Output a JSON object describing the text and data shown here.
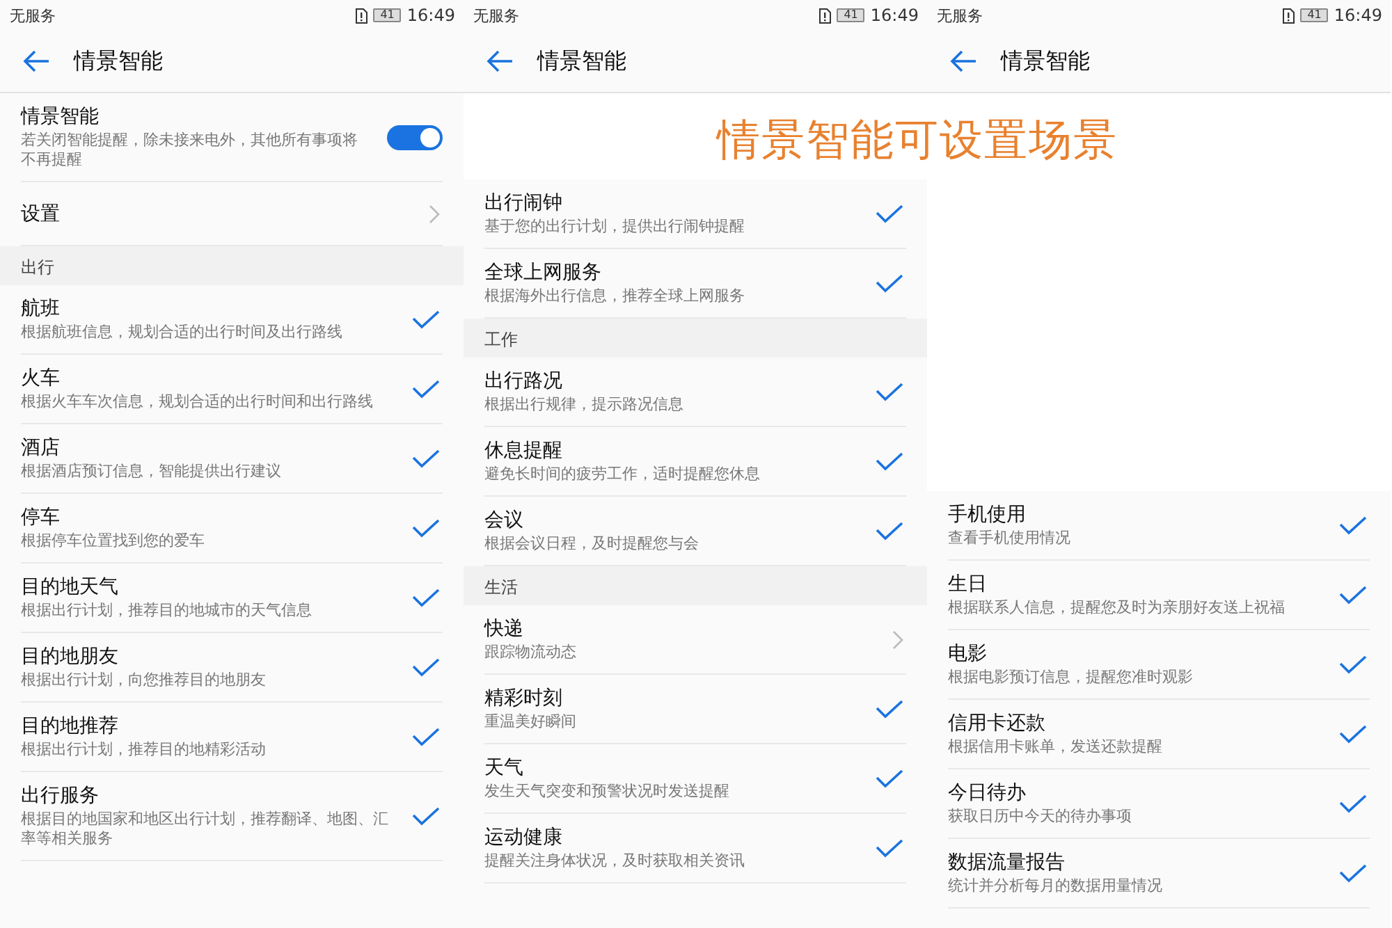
{
  "screens": [
    {
      "status_bar": {
        "carrier": "无服务",
        "battery": "41",
        "time": "16:49"
      },
      "title": "情景智能",
      "items": [
        {
          "kind": "switch",
          "title": "情景智能",
          "subtitle": "若关闭智能提醒，除未接来电外，其他所有事项将不再提醒",
          "on": true
        },
        {
          "kind": "link",
          "title": "设置"
        },
        {
          "kind": "section",
          "title": "出行"
        },
        {
          "kind": "check",
          "title": "航班",
          "subtitle": "根据航班信息，规划合适的出行时间及出行路线",
          "checked": true
        },
        {
          "kind": "check",
          "title": "火车",
          "subtitle": "根据火车车次信息，规划合适的出行时间和出行路线",
          "checked": true
        },
        {
          "kind": "check",
          "title": "酒店",
          "subtitle": "根据酒店预订信息，智能提供出行建议",
          "checked": true
        },
        {
          "kind": "check",
          "title": "停车",
          "subtitle": "根据停车位置找到您的爱车",
          "checked": true
        },
        {
          "kind": "check",
          "title": "目的地天气",
          "subtitle": "根据出行计划，推荐目的地城市的天气信息",
          "checked": true
        },
        {
          "kind": "check",
          "title": "目的地朋友",
          "subtitle": "根据出行计划，向您推荐目的地朋友",
          "checked": true
        },
        {
          "kind": "check",
          "title": "目的地推荐",
          "subtitle": "根据出行计划，推荐目的地精彩活动",
          "checked": true
        },
        {
          "kind": "check",
          "title": "出行服务",
          "subtitle": "根据目的地国家和地区出行计划，推荐翻译、地图、汇率等相关服务",
          "checked": true
        }
      ]
    },
    {
      "status_bar": {
        "carrier": "无服务",
        "battery": "41",
        "time": "16:49"
      },
      "title": "情景智能",
      "items": [
        {
          "kind": "banner"
        },
        {
          "kind": "check",
          "title": "出行闹钟",
          "subtitle": "基于您的出行计划，提供出行闹钟提醒",
          "checked": true
        },
        {
          "kind": "check",
          "title": "全球上网服务",
          "subtitle": "根据海外出行信息，推荐全球上网服务",
          "checked": true
        },
        {
          "kind": "section",
          "title": "工作"
        },
        {
          "kind": "check",
          "title": "出行路况",
          "subtitle": "根据出行规律，提示路况信息",
          "checked": true
        },
        {
          "kind": "check",
          "title": "休息提醒",
          "subtitle": "避免长时间的疲劳工作，适时提醒您休息",
          "checked": true
        },
        {
          "kind": "check",
          "title": "会议",
          "subtitle": "根据会议日程，及时提醒您与会",
          "checked": true
        },
        {
          "kind": "section",
          "title": "生活"
        },
        {
          "kind": "link",
          "title": "快递",
          "subtitle": "跟踪物流动态"
        },
        {
          "kind": "check",
          "title": "精彩时刻",
          "subtitle": "重温美好瞬间",
          "checked": true
        },
        {
          "kind": "check",
          "title": "天气",
          "subtitle": "发生天气突变和预警状况时发送提醒",
          "checked": true
        },
        {
          "kind": "check",
          "title": "运动健康",
          "subtitle": "提醒关注身体状况，及时获取相关资讯",
          "checked": true
        }
      ]
    },
    {
      "status_bar": {
        "carrier": "无服务",
        "battery": "41",
        "time": "16:49"
      },
      "title": "情景智能",
      "items": [
        {
          "kind": "cover"
        },
        {
          "kind": "check",
          "title": "手机使用",
          "subtitle": "查看手机使用情况",
          "checked": true
        },
        {
          "kind": "check",
          "title": "生日",
          "subtitle": "根据联系人信息，提醒您及时为亲朋好友送上祝福",
          "checked": true
        },
        {
          "kind": "check",
          "title": "电影",
          "subtitle": "根据电影预订信息，提醒您准时观影",
          "checked": true
        },
        {
          "kind": "check",
          "title": "信用卡还款",
          "subtitle": "根据信用卡账单，发送还款提醒",
          "checked": true
        },
        {
          "kind": "check",
          "title": "今日待办",
          "subtitle": "获取日历中今天的待办事项",
          "checked": true
        },
        {
          "kind": "check",
          "title": "数据流量报告",
          "subtitle": "统计并分析每月的数据用量情况",
          "checked": true
        }
      ]
    }
  ],
  "caption": "情景智能可设置场景"
}
